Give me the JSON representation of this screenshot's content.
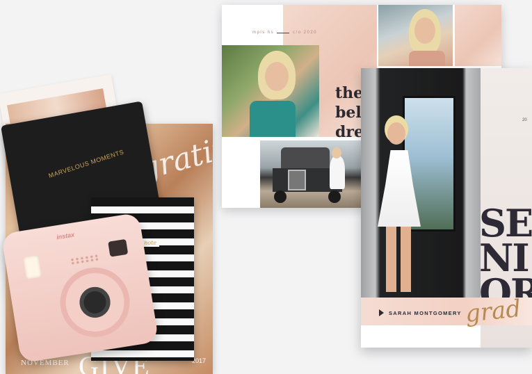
{
  "flatlay": {
    "black_planner_label": "MARVELOUS MOMENTS",
    "stripe_planner_label": "take note",
    "camera_brand": "instax",
    "magazine_script": "gratitude",
    "magazine_month": "NOVEMBER",
    "magazine_title": "GIVE",
    "magazine_issue": "2017"
  },
  "card_one": {
    "tag_left": "mpls hs",
    "tag_right": "c/o 2020",
    "headline_lines": [
      "the",
      "bel",
      "dre"
    ]
  },
  "card_two": {
    "date_mini": "20",
    "big_word_lines": [
      "SE",
      "NI",
      "OR"
    ],
    "student_name": "SARAH MONTGOMERY",
    "script_word": "grad"
  }
}
